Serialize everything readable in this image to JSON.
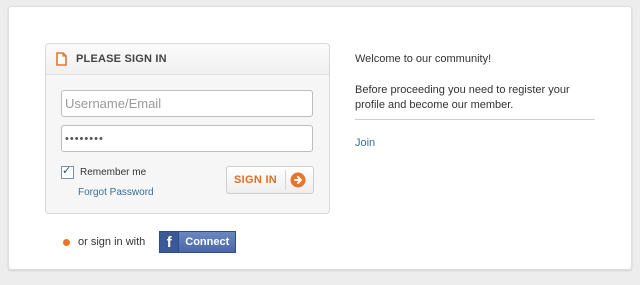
{
  "login": {
    "title": "PLEASE SIGN IN",
    "username_placeholder": "Username/Email",
    "password_value": "••••••••",
    "remember_label": "Remember me",
    "remember_checked": true,
    "forgot_label": "Forgot Password",
    "signin_label": "SIGN IN"
  },
  "social": {
    "or_text": "or sign in with",
    "facebook_letter": "f",
    "facebook_label": "Connect"
  },
  "welcome": {
    "heading": "Welcome to our community!",
    "body": "Before proceeding you need to register your profile and become our member.",
    "join_label": "Join"
  },
  "icons": {
    "header_icon": "document-icon",
    "signin_icon": "arrow-right-circle-icon",
    "bullet_icon": "bullet-icon",
    "checkbox_icon": "checkmark-icon"
  },
  "colors": {
    "accent_orange": "#e0701e",
    "link_blue": "#3a6f99",
    "facebook_blue": "#3b5998"
  }
}
